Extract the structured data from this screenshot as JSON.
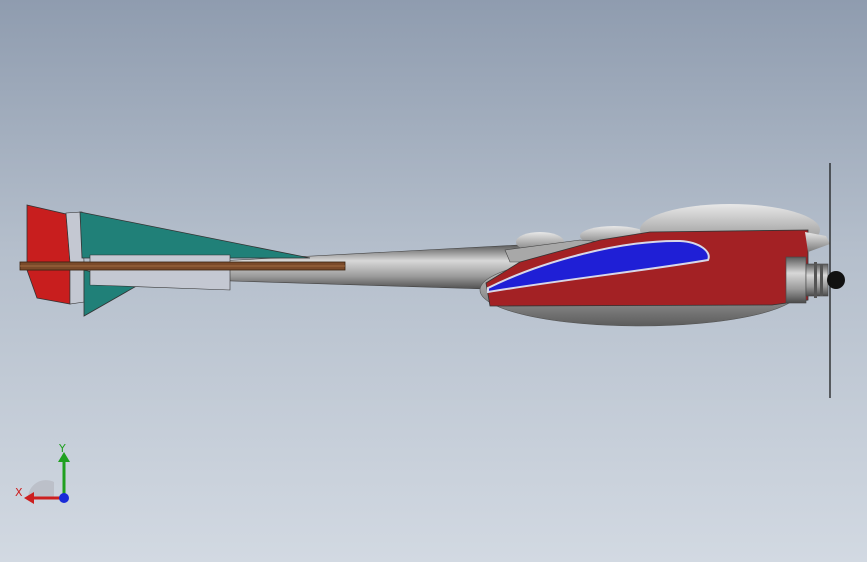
{
  "triad": {
    "x_label": "X",
    "y_label": "Y",
    "x_color": "#cc1f1f",
    "y_color": "#20a020",
    "z_color": "#1a2bd8"
  },
  "model": {
    "tail_fin_color": "#c81e1e",
    "tail_wing_color": "#208078",
    "fuselage_color": "#a32124",
    "wing_color": "#1f1fd6",
    "boom_color": "#7a4a2a"
  }
}
